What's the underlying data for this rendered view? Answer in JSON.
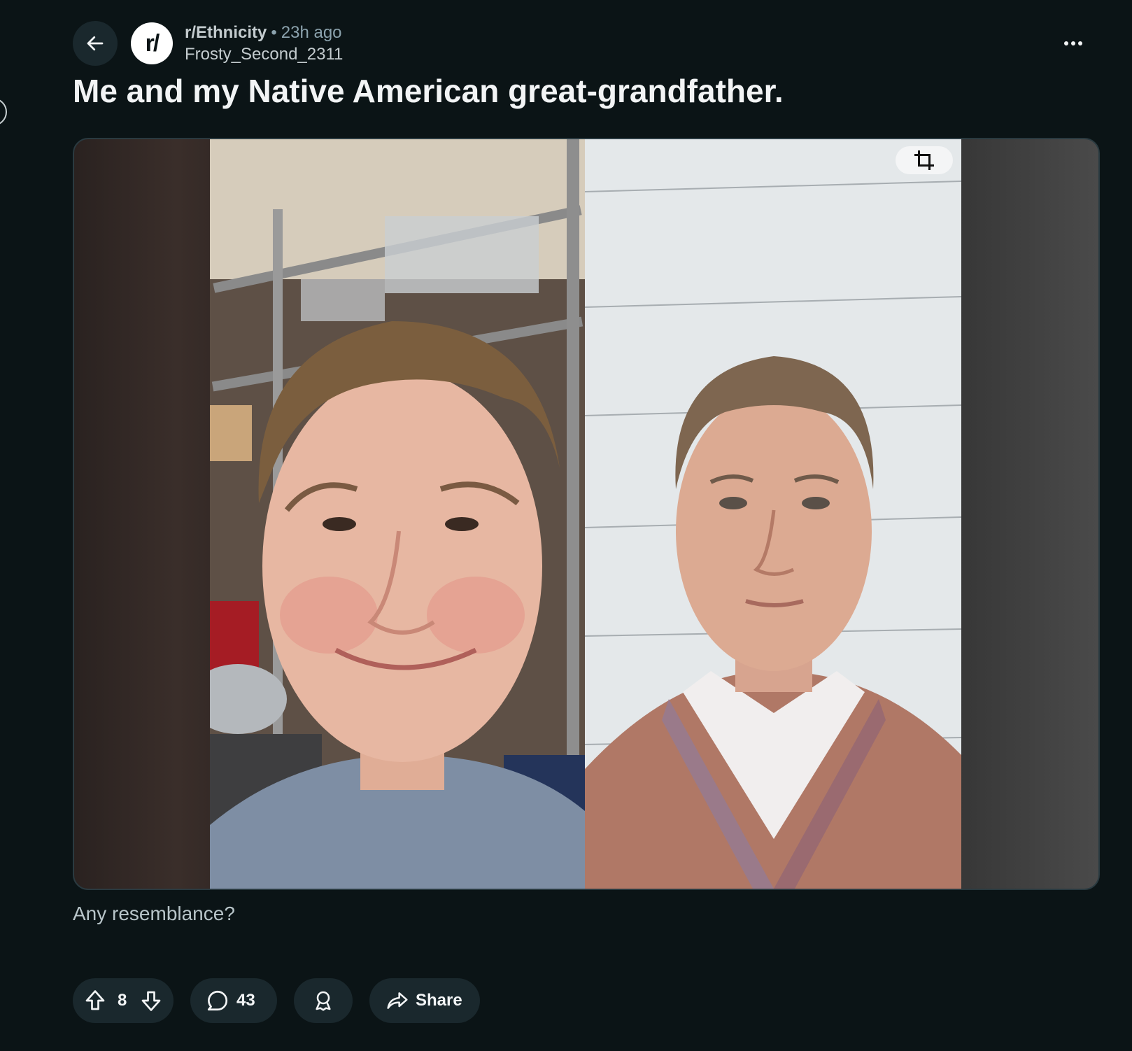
{
  "post": {
    "subreddit": "r/Ethnicity",
    "separator": "•",
    "time": "23h ago",
    "author": "Frosty_Second_2311",
    "avatar_text": "r/",
    "title": "Me and my Native American great-grandfather.",
    "body": "Any resemblance?"
  },
  "actions": {
    "votes": "8",
    "comments": "43",
    "share_label": "Share"
  },
  "icons": {
    "back": "back-arrow-icon",
    "more": "more-horizontal-icon",
    "crop": "crop-icon",
    "upvote": "upvote-arrow-icon",
    "downvote": "downvote-arrow-icon",
    "comment": "comment-bubble-icon",
    "award": "award-icon",
    "share": "share-arrow-icon"
  },
  "colors": {
    "background": "#0b1416",
    "pill": "#1a282d",
    "text": "#f2f4f5",
    "muted": "#8ba2ad"
  }
}
